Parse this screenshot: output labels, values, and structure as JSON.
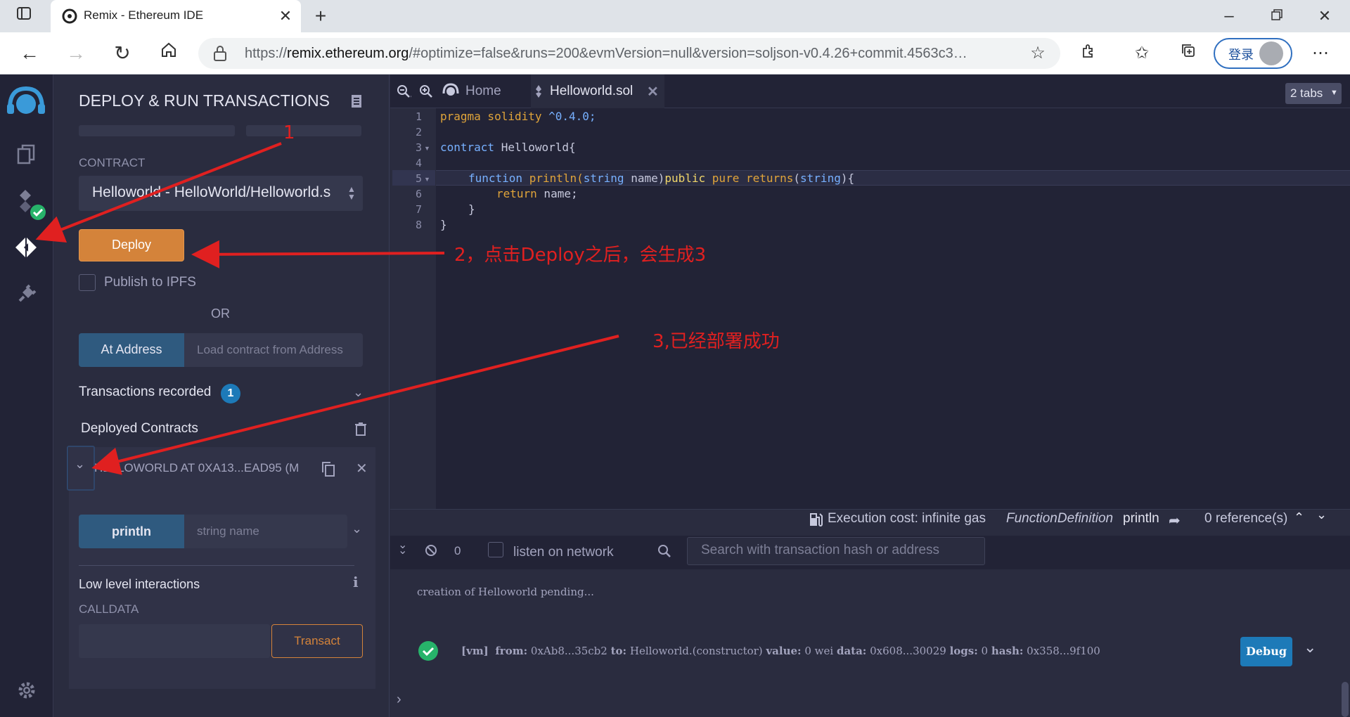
{
  "browser": {
    "tab_title": "Remix - Ethereum IDE",
    "url_prefix": "https://",
    "url_host": "remix.ethereum.org",
    "url_rest": "/#optimize=false&runs=200&evmVersion=null&version=soljson-v0.4.26+commit.4563c3…",
    "login_label": "登录"
  },
  "side_panel": {
    "title": "DEPLOY & RUN TRANSACTIONS",
    "contract_label": "CONTRACT",
    "contract_value": "Helloworld - HelloWorld/Helloworld.s",
    "deploy_label": "Deploy",
    "publish_ipfs_label": "Publish to IPFS",
    "or_label": "OR",
    "at_address_label": "At Address",
    "load_contract_placeholder": "Load contract from Address",
    "transactions_recorded_label": "Transactions recorded",
    "transactions_recorded_count": "1",
    "deployed_contracts_label": "Deployed Contracts",
    "deployed_instance_label": "HELLOWORLD AT 0XA13...EAD95 (M",
    "println_label": "println",
    "println_placeholder": "string name",
    "low_level_label": "Low level interactions",
    "calldata_label": "CALLDATA",
    "transact_label": "Transact"
  },
  "editor": {
    "home_tab": "Home",
    "file_tab": "Helloworld.sol",
    "tabs_count": "2 tabs",
    "line_numbers": [
      "1",
      "2",
      "3",
      "4",
      "5",
      "6",
      "7",
      "8"
    ],
    "code": {
      "l1_kw": "pragma solidity",
      "l1_rest": " ^0.4.0;",
      "l3_kw": "contract",
      "l3_rest": " Helloworld{",
      "l5_fn": "function",
      "l5_name": " println(",
      "l5_type": "string",
      "l5_param": " name)",
      "l5_public": "public",
      "l5_space": " ",
      "l5_pure": "pure",
      "l5_returns": " returns",
      "l5_paren": "(",
      "l5_rettype": "string",
      "l5_end": "){",
      "l6_kw": "return",
      "l6_rest": " name;",
      "l7": "}",
      "l8": "}"
    },
    "status": {
      "execution_cost": "Execution cost: infinite gas",
      "function_def_kind": "FunctionDefinition",
      "function_def_name": "println",
      "references": "0 reference(s)"
    }
  },
  "terminal": {
    "pending_count": "0",
    "listen_label": "listen on network",
    "search_placeholder": "Search with transaction hash or address",
    "creation_msg": "creation of Helloworld pending...",
    "tx_line": {
      "vm": "[vm]",
      "from_label": "from:",
      "from_value": "0xAb8...35cb2",
      "to_label": "to:",
      "to_value": "Helloworld.(constructor)",
      "value_label": "value:",
      "value_value": "0 wei",
      "data_label": "data:",
      "data_value": "0x608...30029",
      "logs_label": "logs:",
      "logs_value": "0",
      "hash_label": "hash:",
      "hash_value": "0x358...9f100"
    },
    "debug_label": "Debug"
  },
  "annotations": {
    "a1": "1",
    "a2": "2，点击Deploy之后，会生成3",
    "a3": "3,已经部署成功"
  },
  "colors": {
    "accent_deploy": "#d4833a",
    "accent_blue": "#2f5a7f",
    "annotation_red": "#e02020",
    "success_green": "#27b36a"
  }
}
